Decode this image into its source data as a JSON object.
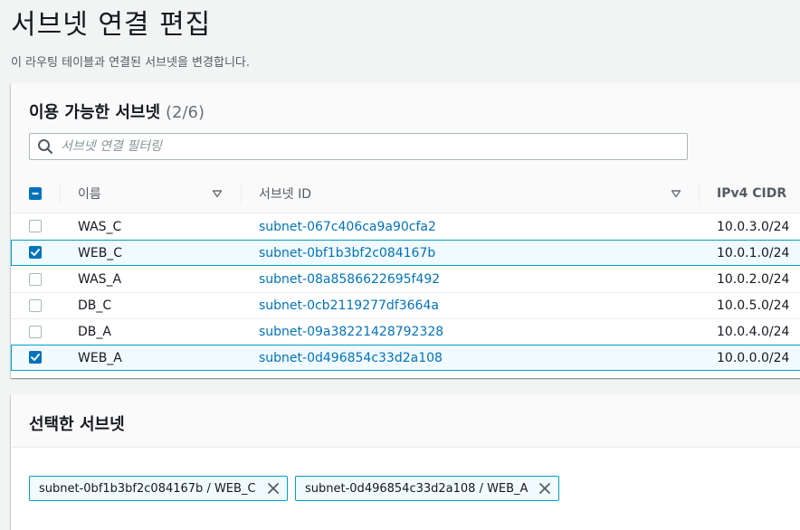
{
  "page": {
    "title": "서브넷 연결 편집",
    "description": "이 라우팅 테이블과 연결된 서브넷을 변경합니다."
  },
  "available": {
    "title": "이용 가능한 서브넷",
    "count": "(2/6)",
    "search_placeholder": "서브넷 연결 필터링",
    "columns": {
      "name": "이름",
      "subnet_id": "서브넷 ID",
      "cidr": "IPv4 CIDR"
    },
    "rows": [
      {
        "name": "WAS_C",
        "subnet_id": "subnet-067c406ca9a90cfa2",
        "cidr": "10.0.3.0/24",
        "selected": false
      },
      {
        "name": "WEB_C",
        "subnet_id": "subnet-0bf1b3bf2c084167b",
        "cidr": "10.0.1.0/24",
        "selected": true
      },
      {
        "name": "WAS_A",
        "subnet_id": "subnet-08a8586622695f492",
        "cidr": "10.0.2.0/24",
        "selected": false
      },
      {
        "name": "DB_C",
        "subnet_id": "subnet-0cb2119277df3664a",
        "cidr": "10.0.5.0/24",
        "selected": false
      },
      {
        "name": "DB_A",
        "subnet_id": "subnet-09a38221428792328",
        "cidr": "10.0.4.0/24",
        "selected": false
      },
      {
        "name": "WEB_A",
        "subnet_id": "subnet-0d496854c33d2a108",
        "cidr": "10.0.0.0/24",
        "selected": true
      }
    ]
  },
  "selected_panel": {
    "title": "선택한 서브넷",
    "tokens": [
      {
        "label": "subnet-0bf1b3bf2c084167b / WEB_C"
      },
      {
        "label": "subnet-0d496854c33d2a108 / WEB_A"
      }
    ]
  },
  "icons": {
    "search": "search-icon",
    "sort": "caret-down-icon",
    "remove": "close-icon",
    "check": "check-icon"
  },
  "colors": {
    "link": "#0073bb",
    "accent": "#0073bb",
    "selected_row_bg": "#f1faff",
    "selected_row_border": "#00a1c9",
    "page_bg": "#f2f3f3"
  }
}
